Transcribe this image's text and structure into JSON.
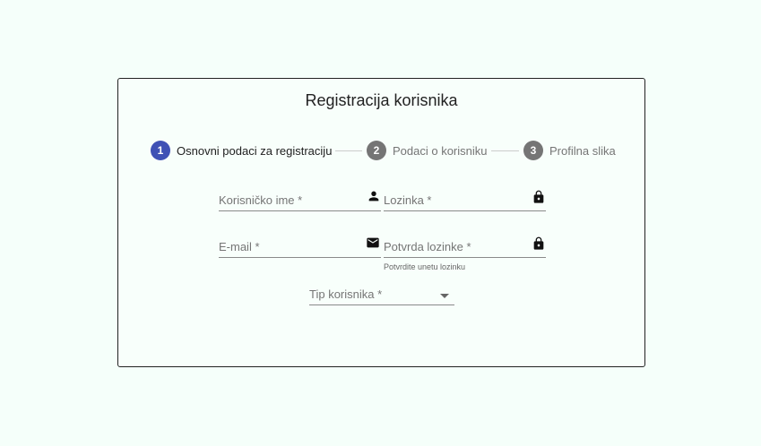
{
  "form": {
    "title": "Registracija korisnika",
    "steps": [
      {
        "number": "1",
        "label": "Osnovni podaci za registraciju",
        "active": true
      },
      {
        "number": "2",
        "label": "Podaci o korisniku",
        "active": false
      },
      {
        "number": "3",
        "label": "Profilna slika",
        "active": false
      }
    ],
    "fields": {
      "username": {
        "placeholder": "Korisničko ime *",
        "icon": "person-icon"
      },
      "password": {
        "placeholder": "Lozinka *",
        "icon": "lock-icon"
      },
      "email": {
        "placeholder": "E-mail *",
        "icon": "mail-icon"
      },
      "password_confirm": {
        "placeholder": "Potvrda lozinke *",
        "icon": "lock-icon",
        "hint": "Potvrdite unetu lozinku"
      },
      "user_type": {
        "placeholder": "Tip korisnika *",
        "icon": "chevron-down-icon"
      }
    }
  },
  "colors": {
    "background": "#f5fffa",
    "step_active": "#3f51b5",
    "step_inactive": "#757575"
  }
}
